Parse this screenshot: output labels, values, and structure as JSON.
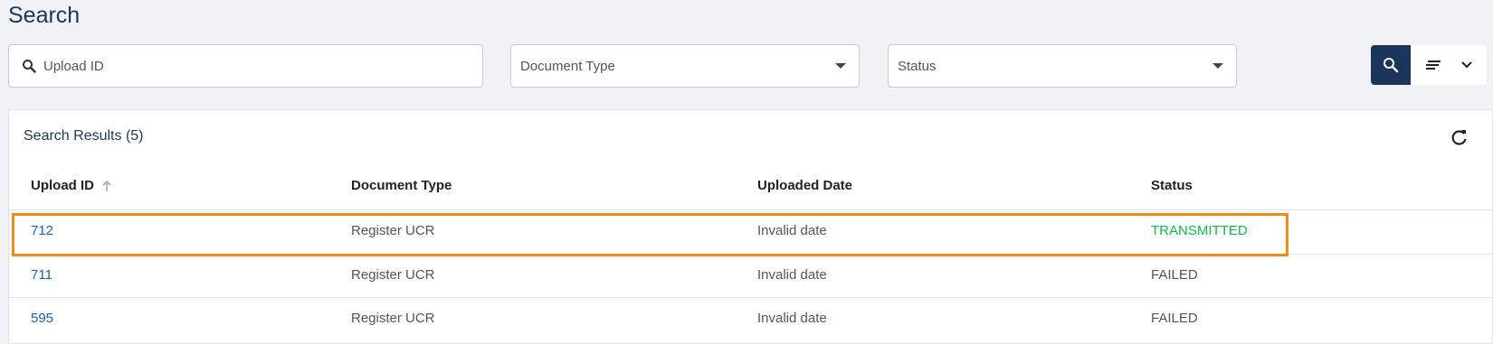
{
  "page": {
    "title": "Search"
  },
  "filters": {
    "search_placeholder": "Upload ID",
    "document_type_label": "Document Type",
    "status_label": "Status"
  },
  "results": {
    "title": "Search Results (5)",
    "columns": [
      "Upload ID",
      "Document Type",
      "Uploaded Date",
      "Status"
    ],
    "rows": [
      {
        "id": "712",
        "type": "Register UCR",
        "date": "Invalid date",
        "status": "TRANSMITTED"
      },
      {
        "id": "711",
        "type": "Register UCR",
        "date": "Invalid date",
        "status": "FAILED"
      },
      {
        "id": "595",
        "type": "Register UCR",
        "date": "Invalid date",
        "status": "FAILED"
      }
    ]
  },
  "colors": {
    "primary": "#1b365d",
    "link": "#1f5fb0",
    "success": "#16b64b",
    "highlight": "#f08a1c"
  },
  "icons": [
    "search-icon",
    "sort-icon",
    "chevron-down-icon",
    "refresh-icon",
    "arrow-up-icon"
  ]
}
